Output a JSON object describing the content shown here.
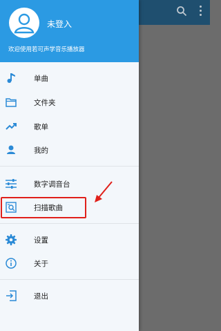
{
  "header": {
    "user_name": "未登入",
    "welcome_text": "欢迎使用若可声学音乐播放器"
  },
  "menu": {
    "items": [
      {
        "label": "单曲",
        "icon": "music-note-icon"
      },
      {
        "label": "文件夹",
        "icon": "folder-icon"
      },
      {
        "label": "歌单",
        "icon": "trending-icon"
      },
      {
        "label": "我的",
        "icon": "person-icon"
      },
      {
        "label": "数字调音台",
        "icon": "equalizer-icon"
      },
      {
        "label": "扫描歌曲",
        "icon": "scan-icon"
      },
      {
        "label": "设置",
        "icon": "settings-gear-icon"
      },
      {
        "label": "关于",
        "icon": "info-icon"
      },
      {
        "label": "退出",
        "icon": "exit-icon"
      }
    ]
  },
  "colors": {
    "header_bg": "#2b9ae3",
    "icon": "#2b8ad6",
    "annotation": "#e0201a",
    "app_bar": "#1f4f6f"
  }
}
